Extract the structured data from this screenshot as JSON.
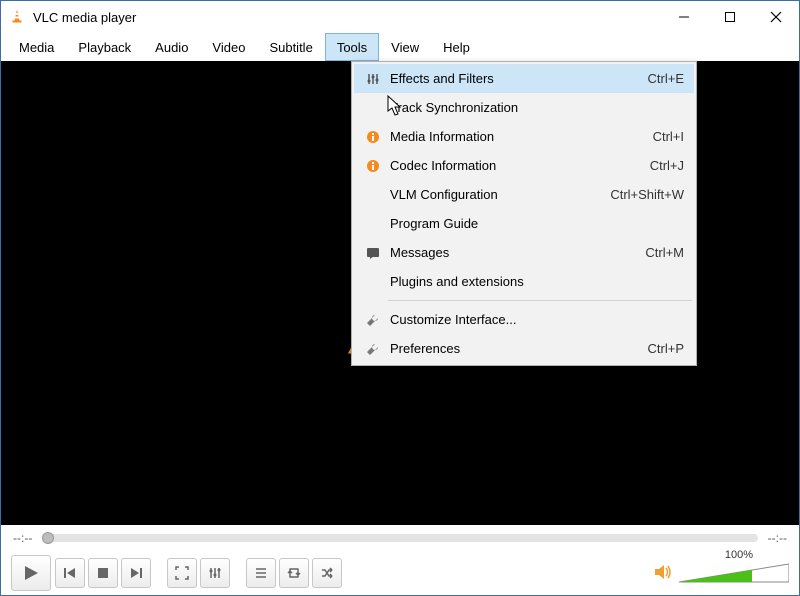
{
  "window": {
    "title": "VLC media player"
  },
  "menubar": [
    "Media",
    "Playback",
    "Audio",
    "Video",
    "Subtitle",
    "Tools",
    "View",
    "Help"
  ],
  "tools_menu": {
    "items": [
      {
        "icon": "equalizer",
        "label": "Effects and Filters",
        "shortcut": "Ctrl+E",
        "hovered": true
      },
      {
        "icon": "",
        "label": "Track Synchronization",
        "shortcut": ""
      },
      {
        "icon": "info",
        "label": "Media Information",
        "shortcut": "Ctrl+I"
      },
      {
        "icon": "info",
        "label": "Codec Information",
        "shortcut": "Ctrl+J"
      },
      {
        "icon": "",
        "label": "VLM Configuration",
        "shortcut": "Ctrl+Shift+W"
      },
      {
        "icon": "",
        "label": "Program Guide",
        "shortcut": ""
      },
      {
        "icon": "messages",
        "label": "Messages",
        "shortcut": "Ctrl+M"
      },
      {
        "icon": "",
        "label": "Plugins and extensions",
        "shortcut": ""
      },
      {
        "sep": true
      },
      {
        "icon": "wrench",
        "label": "Customize Interface...",
        "shortcut": ""
      },
      {
        "icon": "wrench",
        "label": "Preferences",
        "shortcut": "Ctrl+P"
      }
    ]
  },
  "seek": {
    "left": "--:--",
    "right": "--:--"
  },
  "volume": {
    "label": "100%"
  }
}
